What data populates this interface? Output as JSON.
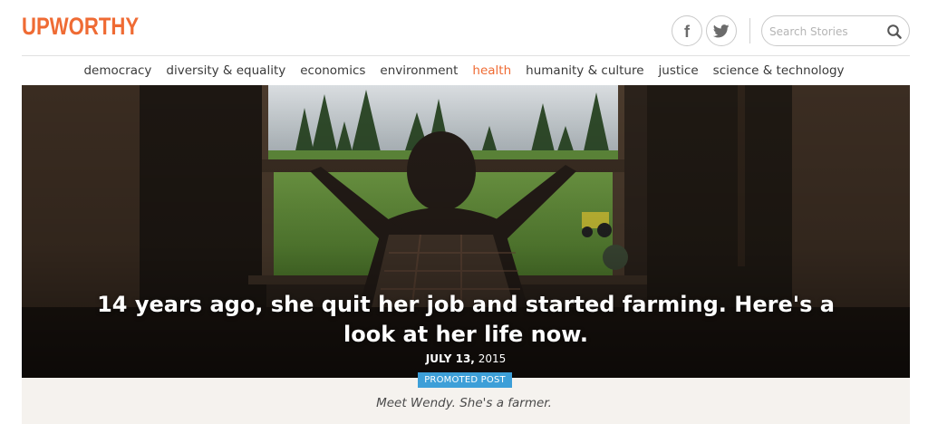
{
  "header": {
    "logo": "UPWORTHY",
    "social": [
      {
        "name": "facebook",
        "icon": "facebook-icon",
        "glyph": "f"
      },
      {
        "name": "twitter",
        "icon": "twitter-icon"
      }
    ],
    "search": {
      "placeholder": "Search Stories",
      "value": "",
      "icon": "search-icon"
    }
  },
  "nav": {
    "items": [
      {
        "label": "democracy",
        "active": false
      },
      {
        "label": "diversity & equality",
        "active": false
      },
      {
        "label": "economics",
        "active": false
      },
      {
        "label": "environment",
        "active": false
      },
      {
        "label": "health",
        "active": true
      },
      {
        "label": "humanity & culture",
        "active": false
      },
      {
        "label": "justice",
        "active": false
      },
      {
        "label": "science & technology",
        "active": false
      }
    ]
  },
  "article": {
    "title": "14 years ago, she quit her job and started farming. Here's a look at her life now.",
    "date_bold": "JULY 13,",
    "date_rest": " 2015",
    "badge": "PROMOTED POST",
    "dek": "Meet Wendy. She's a farmer."
  },
  "colors": {
    "brand": "#ef6b34",
    "badge": "#3d9fd8",
    "band": "#f5f2ee"
  }
}
